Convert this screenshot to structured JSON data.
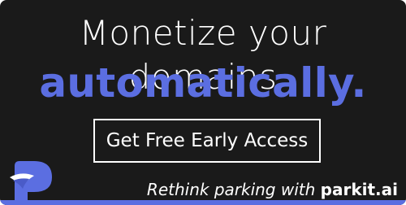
{
  "ad": {
    "headline": "Monetize your domains",
    "emphasis": "automatically.",
    "cta_label": "Get Free Early Access",
    "tagline_lead": "Rethink parking with ",
    "tagline_brand": "parkit.ai",
    "logo_icon": "parkit-p-logo-icon"
  },
  "colors": {
    "background": "#1a1a1a",
    "accent": "#5b6ee1",
    "text": "#ffffff"
  }
}
